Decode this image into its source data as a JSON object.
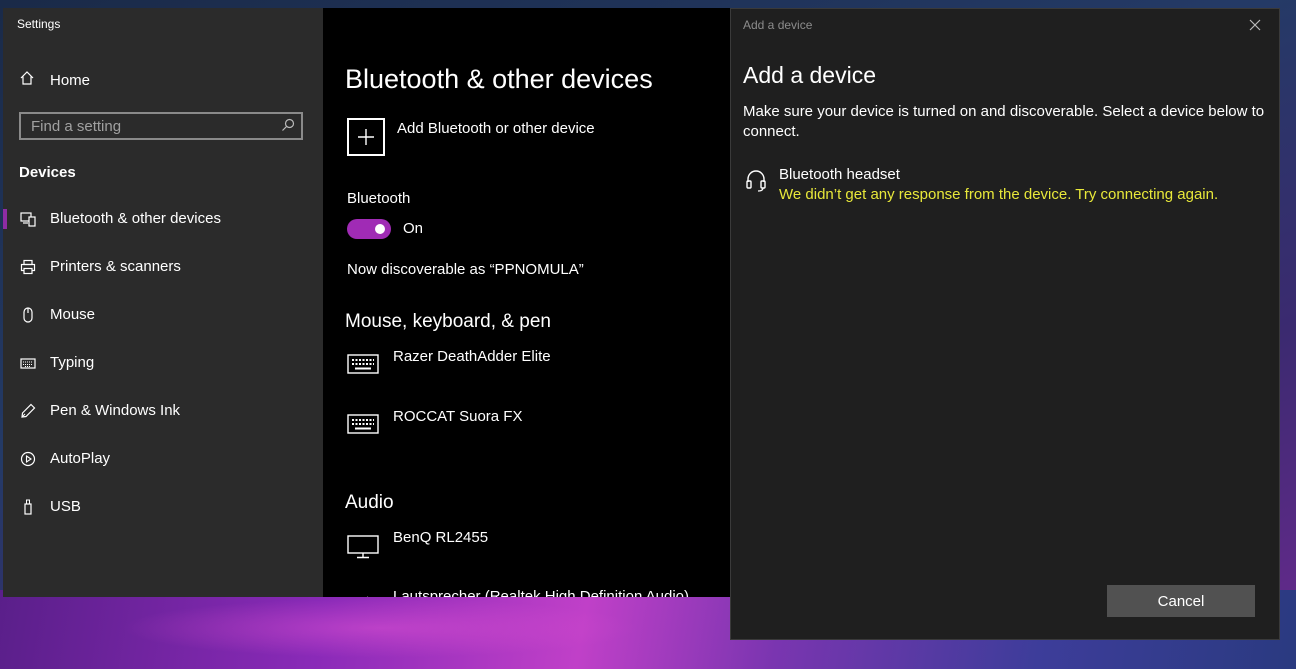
{
  "window": {
    "title": "Settings"
  },
  "sidebar": {
    "home_label": "Home",
    "search": {
      "placeholder": "Find a setting"
    },
    "section_label": "Devices",
    "items": [
      {
        "label": "Bluetooth & other devices",
        "icon": "bluetooth-devices-icon",
        "active": true
      },
      {
        "label": "Printers & scanners",
        "icon": "printer-icon"
      },
      {
        "label": "Mouse",
        "icon": "mouse-icon"
      },
      {
        "label": "Typing",
        "icon": "keyboard-icon"
      },
      {
        "label": "Pen & Windows Ink",
        "icon": "pen-icon"
      },
      {
        "label": "AutoPlay",
        "icon": "autoplay-icon"
      },
      {
        "label": "USB",
        "icon": "usb-icon"
      }
    ]
  },
  "main": {
    "title": "Bluetooth & other devices",
    "add_device_label": "Add Bluetooth or other device",
    "bluetooth_label": "Bluetooth",
    "bluetooth_state": "On",
    "discoverable_text": "Now discoverable as “PPNOMULA”",
    "groups": [
      {
        "title": "Mouse, keyboard, & pen",
        "devices": [
          "Razer DeathAdder Elite",
          "ROCCAT Suora FX"
        ]
      },
      {
        "title": "Audio",
        "devices": [
          "BenQ RL2455",
          "Lautsprecher (Realtek High Definition Audio)"
        ]
      }
    ]
  },
  "dialog": {
    "titlebar": "Add a device",
    "heading": "Add a device",
    "description": "Make sure your device is turned on and discoverable. Select a device below to connect.",
    "found_device": {
      "name": "Bluetooth headset",
      "status": "We didn’t get any response from the device. Try connecting again.",
      "icon": "headset-icon"
    },
    "cancel_label": "Cancel"
  },
  "colors": {
    "accent": "#a02bb5",
    "warning": "#e8e83a",
    "sidebar_bg": "#2b2b2b",
    "dialog_bg": "#1f1f1f"
  }
}
